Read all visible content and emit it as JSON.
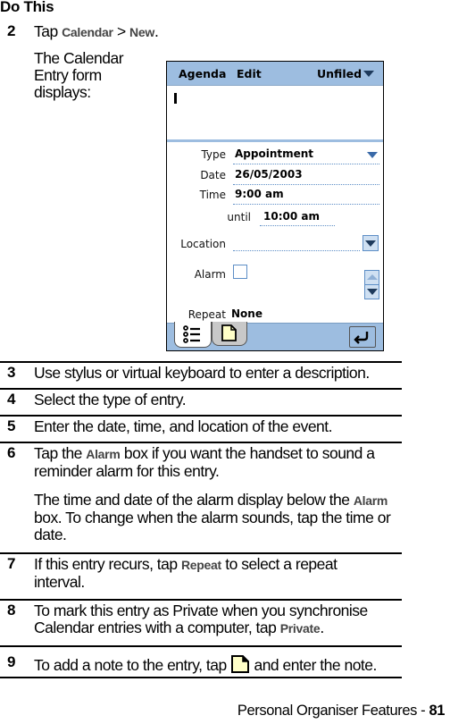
{
  "header": {
    "title": "Do This"
  },
  "steps": [
    {
      "num": "2",
      "parts": [
        "Tap ",
        "Calendar",
        " > ",
        "New",
        "."
      ],
      "sub": "The Calendar Entry form displays:"
    },
    {
      "num": "3",
      "text": "Use stylus or virtual keyboard to enter a description."
    },
    {
      "num": "4",
      "text": "Select the type of entry."
    },
    {
      "num": "5",
      "text": "Enter the date, time, and location of the event."
    },
    {
      "num": "6",
      "parts": [
        "Tap the ",
        "Alarm",
        " box if you want the handset to sound a reminder alarm for this entry."
      ],
      "sub_parts": [
        "The time and date of the alarm display below the ",
        "Alarm",
        " box. To change when the alarm sounds, tap the time or date."
      ]
    },
    {
      "num": "7",
      "parts": [
        "If this entry recurs, tap ",
        "Repeat",
        " to select a repeat interval."
      ]
    },
    {
      "num": "8",
      "parts": [
        "To mark this entry as Private when you synchronise Calendar entries with a computer, tap ",
        "Private",
        "."
      ]
    },
    {
      "num": "9",
      "parts": [
        "To add a note to the entry, tap ",
        " and enter the note."
      ],
      "icon": "note-icon"
    }
  ],
  "device": {
    "menu": {
      "agenda": "Agenda",
      "edit": "Edit",
      "category": "Unfiled"
    },
    "fields": {
      "type_label": "Type",
      "type_value": "Appointment",
      "date_label": "Date",
      "date_value": "26/05/2003",
      "time_label": "Time",
      "time_value": "9:00 am",
      "until_label": "until",
      "until_value": "10:00 am",
      "location_label": "Location",
      "location_value": "",
      "alarm_label": "Alarm",
      "alarm_checked": false,
      "repeat_label": "Repeat",
      "repeat_value": "None"
    },
    "tabs": [
      "details-tab",
      "note-tab"
    ],
    "colors": {
      "bar": "#9dbde0",
      "accent": "#5d8ec6",
      "note": "#ffffc8"
    }
  },
  "footer": {
    "section": "Personal Organiser Features - ",
    "page": "81"
  }
}
